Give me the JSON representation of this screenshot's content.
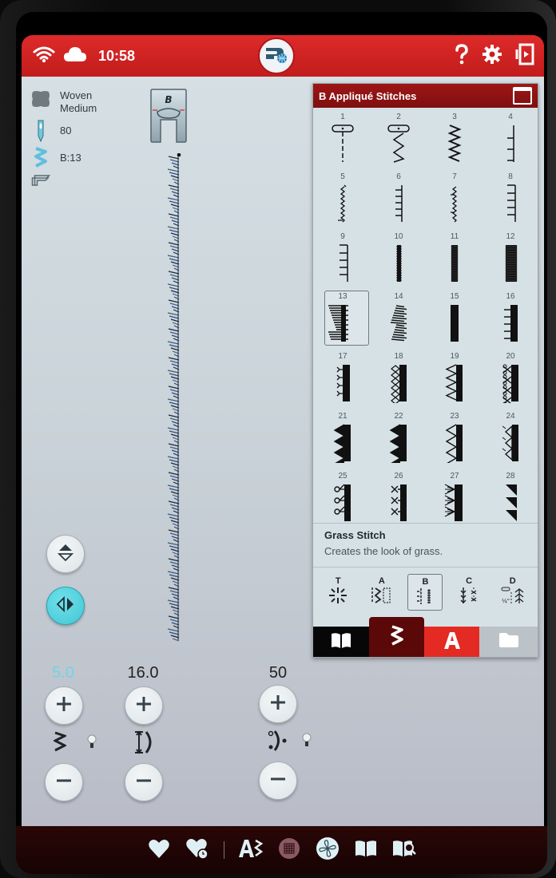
{
  "status_bar": {
    "time": "10:58",
    "icons": [
      "wifi-icon",
      "cloud-icon",
      "mysewnet-icon",
      "help-icon",
      "settings-icon",
      "exit-icon"
    ]
  },
  "info": {
    "fabric": "Woven Medium",
    "fabric_line1": "Woven",
    "fabric_line2": "Medium",
    "needle": "80",
    "stitch": "B:13",
    "presser_foot": "B"
  },
  "controls": {
    "width_value": "5.0",
    "length_value": "16.0",
    "tension_value": "50",
    "plus_label": "+",
    "minus_label": "−"
  },
  "panel": {
    "title": "B Appliqué Stitches",
    "selected_stitch": 13,
    "stitches": [
      "1",
      "2",
      "3",
      "4",
      "5",
      "6",
      "7",
      "8",
      "9",
      "10",
      "11",
      "12",
      "13",
      "14",
      "15",
      "16",
      "17",
      "18",
      "19",
      "20",
      "21",
      "22",
      "23",
      "24",
      "25",
      "26",
      "27",
      "28"
    ],
    "description_title": "Grass Stitch",
    "description_text": "Creates the look of grass.",
    "categories": [
      {
        "label": "T",
        "icon": "tapering-icon"
      },
      {
        "label": "A",
        "icon": "utility-stitches-icon"
      },
      {
        "label": "B",
        "icon": "applique-stitches-icon"
      },
      {
        "label": "C",
        "icon": "quilt-stitches-icon"
      },
      {
        "label": "D",
        "icon": "quilt-heirloom-icon"
      }
    ],
    "selected_category": "B",
    "tabs": [
      "book-icon",
      "stitch-icon",
      "font-icon",
      "folder-icon"
    ],
    "selected_tab": "stitch-icon",
    "colors": {
      "header": "#9e1616",
      "tab_stitch": "#5a0808",
      "tab_font": "#e32b23"
    }
  },
  "bottom_bar": {
    "icons": [
      "favorite-icon",
      "history-icon",
      "stitch-creator-icon",
      "grid-icon",
      "embroidery-icon",
      "guide-icon",
      "guide-search-icon"
    ]
  },
  "colors": {
    "topbar": "#d22424",
    "accent_teal": "#43c7d4"
  }
}
